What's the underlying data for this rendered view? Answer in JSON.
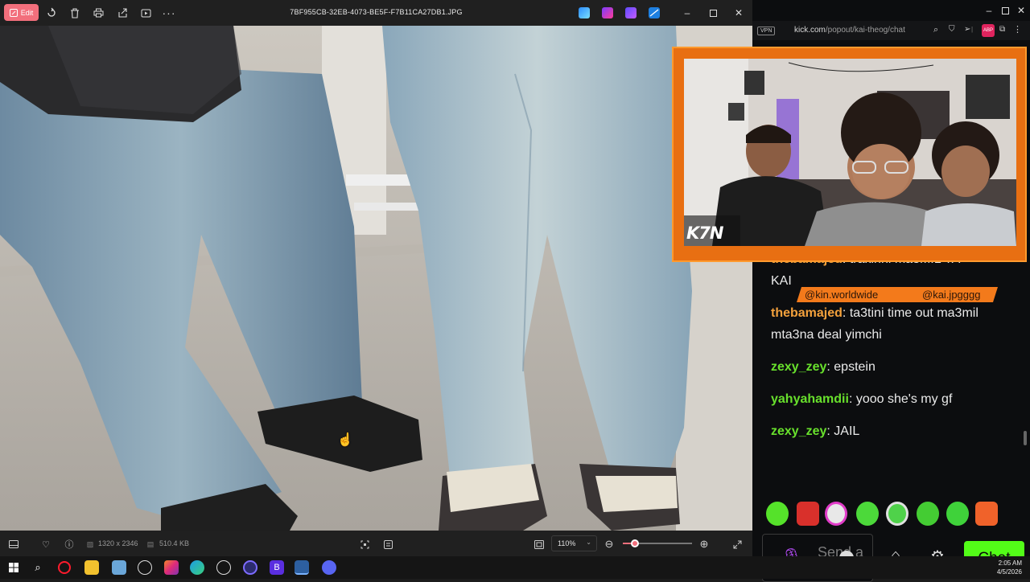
{
  "viewer": {
    "edit_label": "Edit",
    "file_name": "7BF955CB-32EB-4073-BE5F-F7B11CA27DB1.JPG",
    "status": {
      "dimensions": "1320 x 2346",
      "file_size": "510.4 KB",
      "zoom": "110%"
    },
    "zoom_slider_fraction": 0.17
  },
  "browser": {
    "vpn": "VPN",
    "url_host": "kick.com",
    "url_path": "/popout/kai-theog/chat"
  },
  "stream": {
    "logo": "K7N",
    "tags": [
      "@kin.worldwide",
      "@kai.jpgggg"
    ]
  },
  "chat": {
    "messages": [
      {
        "user": "thebamajed",
        "text": ": trakinni ma3MIL YA",
        "color": "orange"
      },
      {
        "user": "",
        "text": "KAI",
        "color": "none"
      },
      {
        "user": "thebamajed",
        "text": ": ta3tini time out ma3mil mta3na deal yimchi",
        "color": "orange"
      },
      {
        "user": "zexy_zey",
        "text": ": epstein",
        "color": "green"
      },
      {
        "user": "yahyahamdii",
        "text": ": yooo she's my gf",
        "color": "green"
      },
      {
        "user": "zexy_zey",
        "text": ": JAIL",
        "color": "green"
      }
    ],
    "input_placeholder": "Send a message",
    "send_button": "Chat"
  },
  "taskbar": {
    "time": "2:05 AM",
    "date": "4/5/2026"
  },
  "colors": {
    "kick_green": "#53fc18",
    "stream_orange": "#e86f12",
    "edit_pink": "#f26f7c",
    "user_orange": "#f4a13c",
    "user_green": "#68e02c"
  }
}
